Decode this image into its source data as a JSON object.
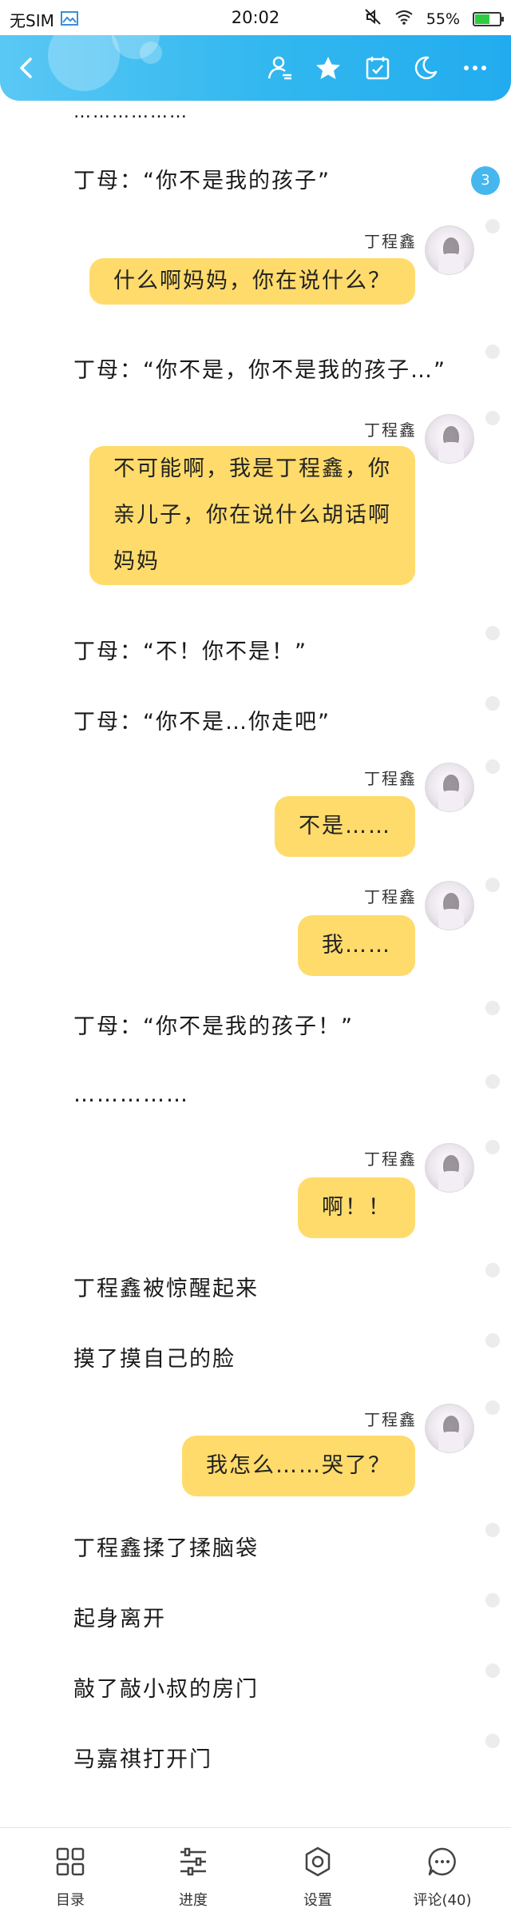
{
  "status_bar": {
    "carrier": "无SIM",
    "time": "20:02",
    "battery": "55%",
    "battery_level": 0.55
  },
  "header": {
    "icons": [
      "back-icon",
      "author-icon",
      "star-icon",
      "calendar-check-icon",
      "moon-icon",
      "more-icon"
    ]
  },
  "content": {
    "top_ellipsis": "………………",
    "comment_badge": "3",
    "items": [
      {
        "type": "narration",
        "text": "丁母：“你不是我的孩子”"
      },
      {
        "type": "message",
        "speaker": "丁程鑫",
        "text": "什么啊妈妈，你在说什么？"
      },
      {
        "type": "narration",
        "text": "丁母：“你不是，你不是我的孩子…”"
      },
      {
        "type": "message",
        "speaker": "丁程鑫",
        "lines": [
          "不可能啊，我是丁程鑫，你",
          "亲儿子，你在说什么胡话啊",
          "妈妈"
        ]
      },
      {
        "type": "narration",
        "text": "丁母：“不！你不是！”"
      },
      {
        "type": "narration",
        "text": "丁母：“你不是…你走吧”"
      },
      {
        "type": "message",
        "speaker": "丁程鑫",
        "text": "不是……"
      },
      {
        "type": "message",
        "speaker": "丁程鑫",
        "text": "我……"
      },
      {
        "type": "narration",
        "text": "丁母：“你不是我的孩子！”"
      },
      {
        "type": "narration",
        "text": "……………"
      },
      {
        "type": "message",
        "speaker": "丁程鑫",
        "text": "啊！！"
      },
      {
        "type": "narration",
        "text": "丁程鑫被惊醒起来"
      },
      {
        "type": "narration",
        "text": "摸了摸自己的脸"
      },
      {
        "type": "message",
        "speaker": "丁程鑫",
        "text": "我怎么……哭了？"
      },
      {
        "type": "narration",
        "text": "丁程鑫揉了揉脑袋"
      },
      {
        "type": "narration",
        "text": "起身离开"
      },
      {
        "type": "narration",
        "text": "敲了敲小叔的房门"
      },
      {
        "type": "narration",
        "text": "马嘉祺打开门"
      }
    ]
  },
  "bottom_bar": {
    "items": [
      {
        "label": "目录",
        "icon": "grid-icon"
      },
      {
        "label": "进度",
        "icon": "sliders-icon"
      },
      {
        "label": "设置",
        "icon": "gear-icon"
      },
      {
        "label": "评论(40)",
        "icon": "comment-icon"
      }
    ]
  },
  "colors": {
    "header": "#33b8ef",
    "bubble": "#fedb6b",
    "badge": "#46b7ee"
  }
}
